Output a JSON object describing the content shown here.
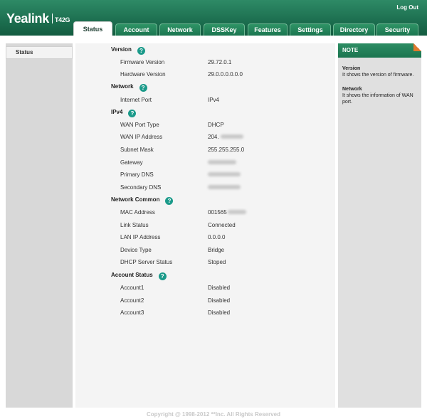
{
  "header": {
    "brand": "Yealink",
    "model": "T42G",
    "logout_label": "Log Out"
  },
  "tabs": [
    {
      "label": "Status",
      "active": true
    },
    {
      "label": "Account"
    },
    {
      "label": "Network"
    },
    {
      "label": "DSSKey"
    },
    {
      "label": "Features"
    },
    {
      "label": "Settings"
    },
    {
      "label": "Directory"
    },
    {
      "label": "Security"
    }
  ],
  "sidebar": {
    "items": [
      {
        "label": "Status"
      }
    ]
  },
  "sections": {
    "version": {
      "title": "Version",
      "rows": [
        {
          "label": "Firmware Version",
          "value": "29.72.0.1"
        },
        {
          "label": "Hardware Version",
          "value": "29.0.0.0.0.0.0"
        }
      ]
    },
    "network": {
      "title": "Network",
      "rows": [
        {
          "label": "Internet Port",
          "value": "IPv4"
        }
      ]
    },
    "ipv4": {
      "title": "IPv4",
      "rows": [
        {
          "label": "WAN Port Type",
          "value": "DHCP"
        },
        {
          "label": "WAN IP Address",
          "value": "204."
        },
        {
          "label": "Subnet Mask",
          "value": "255.255.255.0"
        },
        {
          "label": "Gateway",
          "value": ""
        },
        {
          "label": "Primary DNS",
          "value": ""
        },
        {
          "label": "Secondary DNS",
          "value": ""
        }
      ]
    },
    "network_common": {
      "title": "Network Common",
      "rows": [
        {
          "label": "MAC Address",
          "value": "001565"
        },
        {
          "label": "Link Status",
          "value": "Connected"
        },
        {
          "label": "LAN IP Address",
          "value": "0.0.0.0"
        },
        {
          "label": "Device Type",
          "value": "Bridge"
        },
        {
          "label": "DHCP Server Status",
          "value": "Stoped"
        }
      ]
    },
    "account_status": {
      "title": "Account Status",
      "rows": [
        {
          "label": "Account1",
          "value": "Disabled"
        },
        {
          "label": "Account2",
          "value": "Disabled"
        },
        {
          "label": "Account3",
          "value": "Disabled"
        }
      ]
    }
  },
  "note": {
    "title": "NOTE",
    "items": [
      {
        "title": "Version",
        "text": "It shows the version of firmware."
      },
      {
        "title": "Network",
        "text": "It shows the information of WAN port."
      }
    ]
  },
  "footer": "Copyright @ 1998-2012 **Inc. All Rights Reserved",
  "colors": {
    "header_green": "#1c6e4f",
    "help_icon": "#1b9a8a",
    "note_fold": "#e07a2e"
  }
}
